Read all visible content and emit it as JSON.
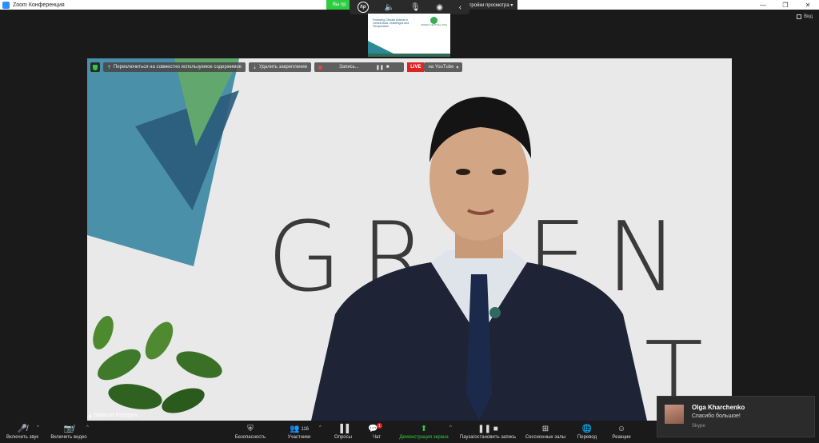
{
  "window": {
    "title": "Zoom Конференция",
    "controls": [
      "—",
      "❐",
      "✕"
    ]
  },
  "share_bar": {
    "status": "Вы пр",
    "view_options": "тройки просмотра ▾"
  },
  "hp_toolbar": {
    "logo": "hp"
  },
  "thumbnail": {
    "slide_title": "Financing Climate Actions in Central Asia: Challenges and Perspectives",
    "logo_text": "GREEN CENTRAL ASIA"
  },
  "view_button": {
    "label": "Вид"
  },
  "video_overlay": {
    "switch_label": "Переключиться на совместно используемое содержимое",
    "unpin_label": "Удалить закрепление",
    "recording_label": "Запись...",
    "live_badge": "LIVE",
    "youtube_label": "на YouTube"
  },
  "backdrop": {
    "letters_top": "GREEN",
    "letters_bottom": "AT"
  },
  "participant": {
    "name": "Salamat Erejepov"
  },
  "toolbar": {
    "mute_label": "Включить звук",
    "video_label": "Включить видео",
    "security_label": "Безопасность",
    "participants_label": "Участники",
    "participants_count": "116",
    "polls_label": "Опросы",
    "chat_label": "Чат",
    "chat_badge": "1",
    "share_label": "Демонстрация экрана",
    "pause_rec_label": "Пауза/остановить запись",
    "breakout_label": "Сессионные залы",
    "translate_label": "Перевод",
    "reactions_label": "Реакции"
  },
  "notification": {
    "sender": "Olga Kharchenko",
    "message": "Спасибо большое!",
    "app": "Skype"
  }
}
